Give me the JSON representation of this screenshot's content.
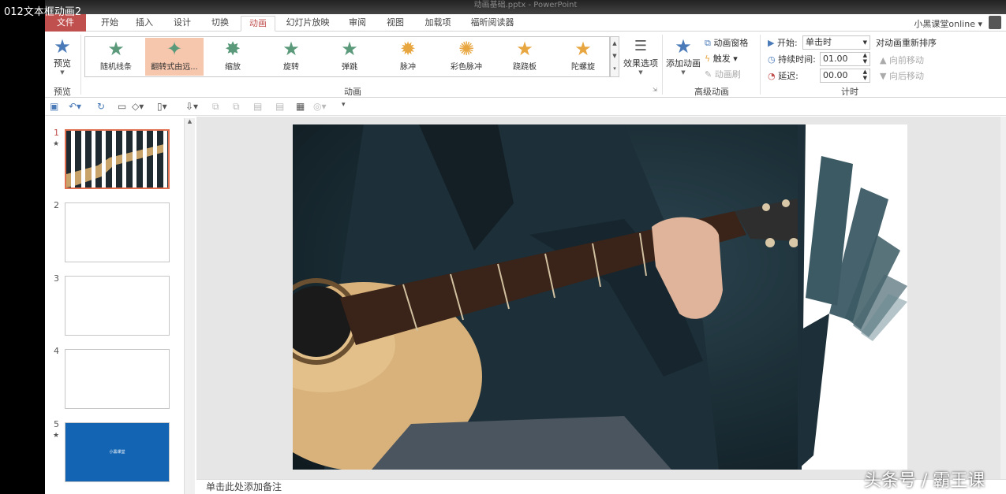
{
  "video_title": "012文本框动画2",
  "window_title": "动画基础.pptx - PowerPoint",
  "tabs": {
    "file": "文件",
    "items": [
      "开始",
      "插入",
      "设计",
      "切换",
      "动画",
      "幻灯片放映",
      "审阅",
      "视图",
      "加载项",
      "福昕阅读器"
    ],
    "active": "动画"
  },
  "user": {
    "name": "小黑课堂online ▾"
  },
  "ribbon": {
    "preview": {
      "label": "预览",
      "group": "预览"
    },
    "animation_group": "动画",
    "animations": [
      {
        "label": "随机线条",
        "icon": "star-icon",
        "color": "#5a9a7a"
      },
      {
        "label": "翻转式由远...",
        "icon": "star-icon",
        "color": "#5a9a7a"
      },
      {
        "label": "缩放",
        "icon": "star-icon",
        "color": "#5a9a7a"
      },
      {
        "label": "旋转",
        "icon": "star-icon",
        "color": "#5a9a7a"
      },
      {
        "label": "弹跳",
        "icon": "star-icon",
        "color": "#5a9a7a"
      },
      {
        "label": "脉冲",
        "icon": "star-icon",
        "color": "#e8a640"
      },
      {
        "label": "彩色脉冲",
        "icon": "star-icon",
        "color": "#e8a640"
      },
      {
        "label": "跷跷板",
        "icon": "star-icon",
        "color": "#e8a640"
      },
      {
        "label": "陀螺旋",
        "icon": "star-icon",
        "color": "#e8a640"
      }
    ],
    "effect_options": "效果选项",
    "advanced": {
      "group": "高级动画",
      "add_animation": "添加动画",
      "animation_pane": "动画窗格",
      "trigger": "触发",
      "painter": "动画刷"
    },
    "timing": {
      "group": "计时",
      "start_label": "开始:",
      "start_value": "单击时",
      "duration_label": "持续时间:",
      "duration_value": "01.00",
      "delay_label": "延迟:",
      "delay_value": "00.00",
      "reorder_title": "对动画重新排序",
      "move_earlier": "向前移动",
      "move_later": "向后移动"
    }
  },
  "slides": [
    {
      "num": "1",
      "star": "★",
      "current": true
    },
    {
      "num": "2"
    },
    {
      "num": "3"
    },
    {
      "num": "4"
    },
    {
      "num": "5",
      "star": "★",
      "text": "小黑课堂"
    }
  ],
  "notes_placeholder": "单击此处添加备注",
  "watermark": "头条号 / 霸王课"
}
